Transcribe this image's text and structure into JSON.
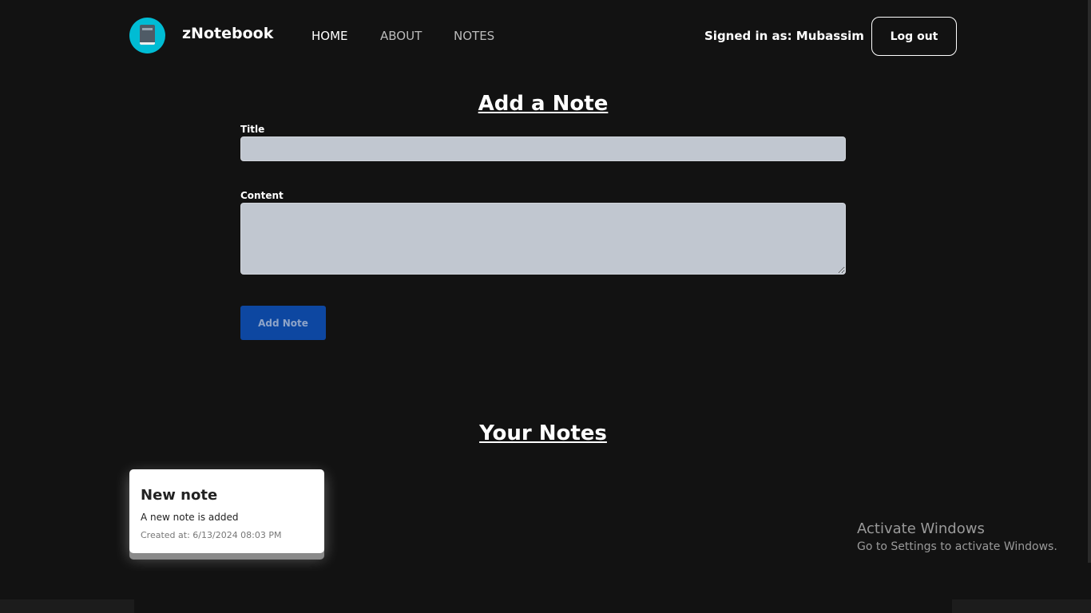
{
  "nav": {
    "brand": "zNotebook",
    "links": [
      "HOME",
      "ABOUT",
      "NOTES"
    ],
    "signed_in": "Signed in as: Mubassim",
    "logout": "Log out"
  },
  "form": {
    "heading": "Add a Note",
    "title_label": "Title",
    "title_value": "",
    "content_label": "Content",
    "content_value": "",
    "submit": "Add Note"
  },
  "notes": {
    "heading": "Your Notes",
    "items": [
      {
        "title": "New note",
        "content": "A new note is added",
        "created": "Created at: 6/13/2024 08:03 PM"
      }
    ]
  },
  "watermark": {
    "line1": "Activate Windows",
    "line2": "Go to Settings to activate Windows."
  },
  "colors": {
    "accent": "#00bcd4",
    "button": "#0d47a1",
    "background": "#121212"
  }
}
